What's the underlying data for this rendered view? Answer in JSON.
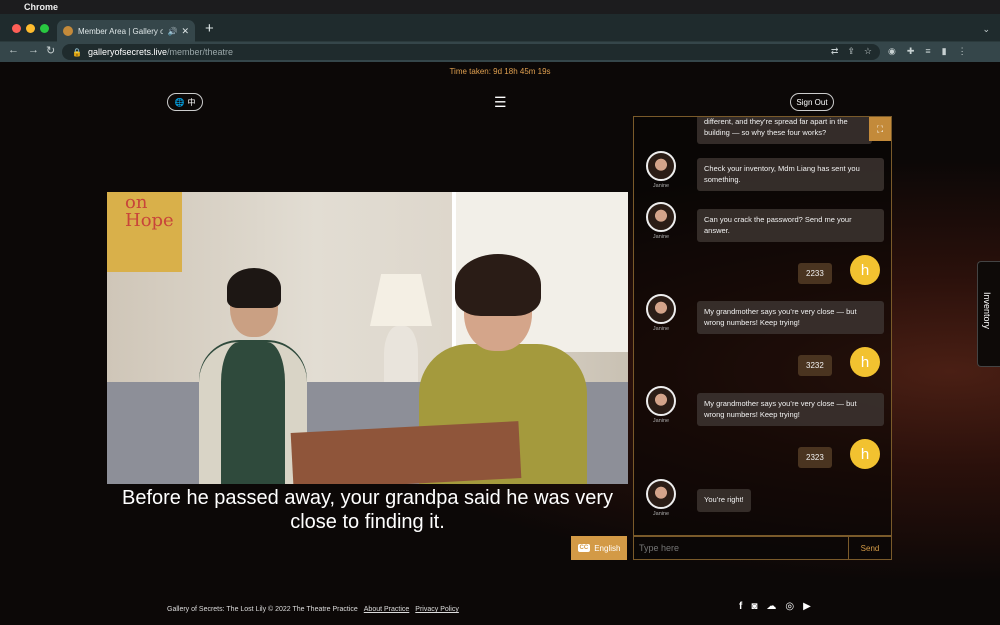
{
  "os": {
    "app_name": "Chrome"
  },
  "browser": {
    "tab_title": "Member Area | Gallery of Se",
    "url_host": "galleryofsecrets.live",
    "url_path": "/member/theatre"
  },
  "header": {
    "timer_label": "Time taken: 9d 18h 45m 19s",
    "lang_label": "中",
    "menu_icon": "☰",
    "signout_label": "Sign Out"
  },
  "video": {
    "poster_text": "on\nHope",
    "subtitle": "Before he passed away, your grandpa said he was very close to finding it.",
    "lang_toggle": "English",
    "cc_label": "CC"
  },
  "chat": {
    "messages": [
      {
        "from": "npc",
        "text": "different, and they’re spread far apart in the building — so why these four works?"
      },
      {
        "from": "npc",
        "name": "Janine",
        "text": "Check your inventory, Mdm Liang has sent you something."
      },
      {
        "from": "npc",
        "name": "Janine",
        "text": "Can you crack the password? Send me your answer."
      },
      {
        "from": "user",
        "avatar": "h",
        "text": "2233"
      },
      {
        "from": "npc",
        "name": "Janine",
        "text": "My grandmother says you’re very close — but wrong numbers! Keep trying!"
      },
      {
        "from": "user",
        "avatar": "h",
        "text": "3232"
      },
      {
        "from": "npc",
        "name": "Janine",
        "text": "My grandmother says you’re very close — but wrong numbers! Keep trying!"
      },
      {
        "from": "user",
        "avatar": "h",
        "text": "2323"
      },
      {
        "from": "npc",
        "name": "Janine",
        "text": "You’re right!"
      }
    ],
    "input_placeholder": "Type here",
    "send_label": "Send"
  },
  "inventory_label": "Inventory",
  "footer": {
    "copyright": "Gallery of Secrets: The Lost Lily © 2022 The Theatre Practice",
    "about_link": "About Practice",
    "privacy_link": "Privacy Policy"
  },
  "social_icons": [
    "facebook-icon",
    "instagram-icon",
    "wechat-icon",
    "weibo-icon",
    "youtube-icon"
  ]
}
